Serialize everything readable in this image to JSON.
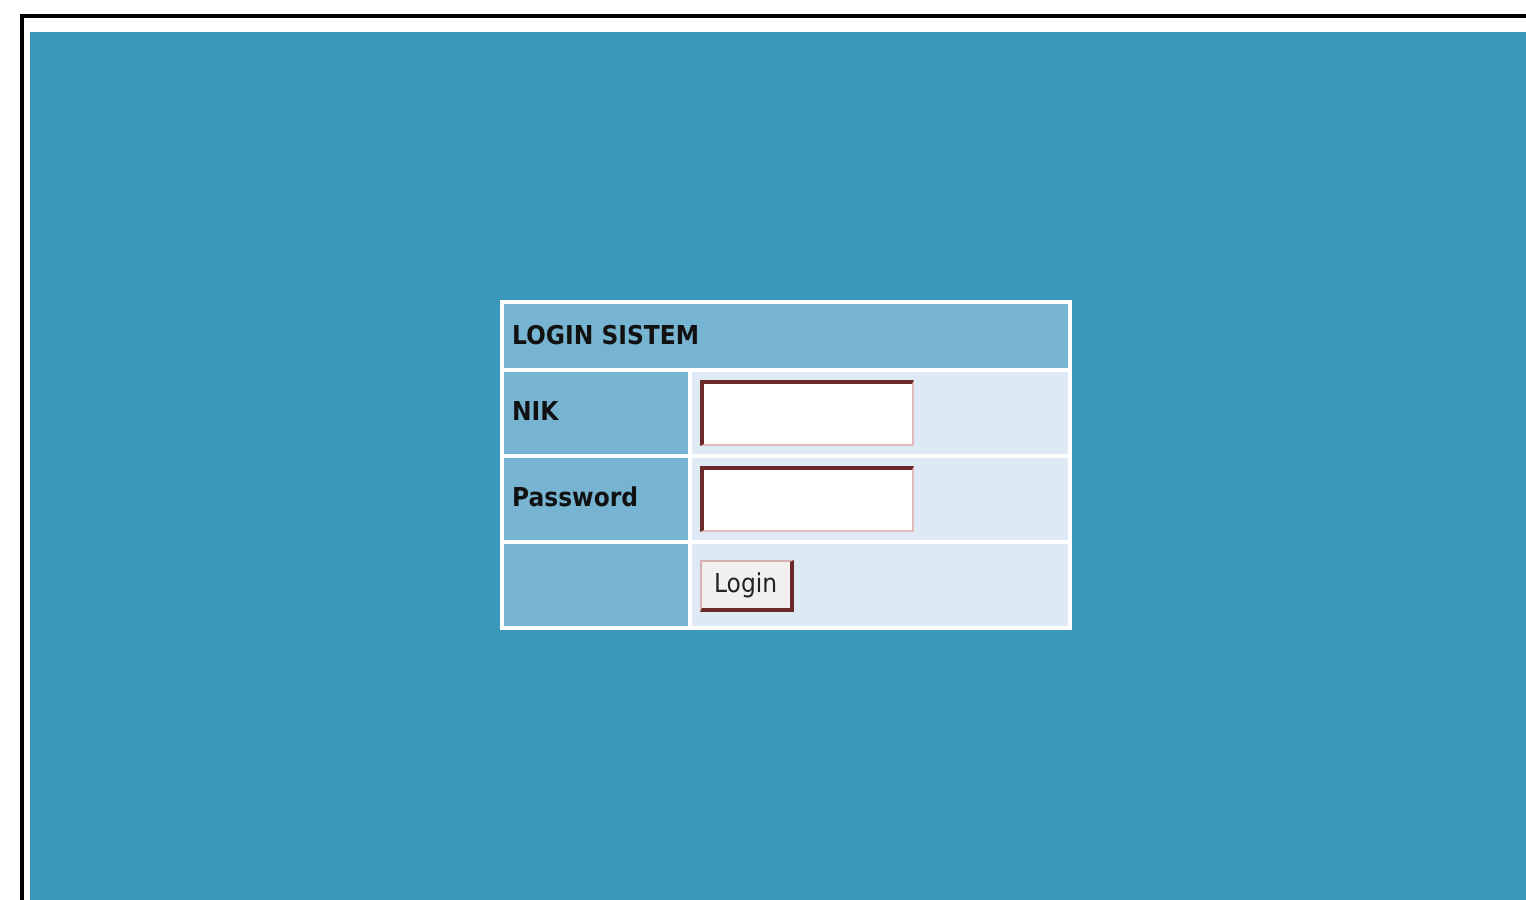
{
  "login_form": {
    "title": "LOGIN SISTEM",
    "fields": [
      {
        "label": "NIK"
      },
      {
        "label": "Password"
      }
    ],
    "button": "Login"
  }
}
